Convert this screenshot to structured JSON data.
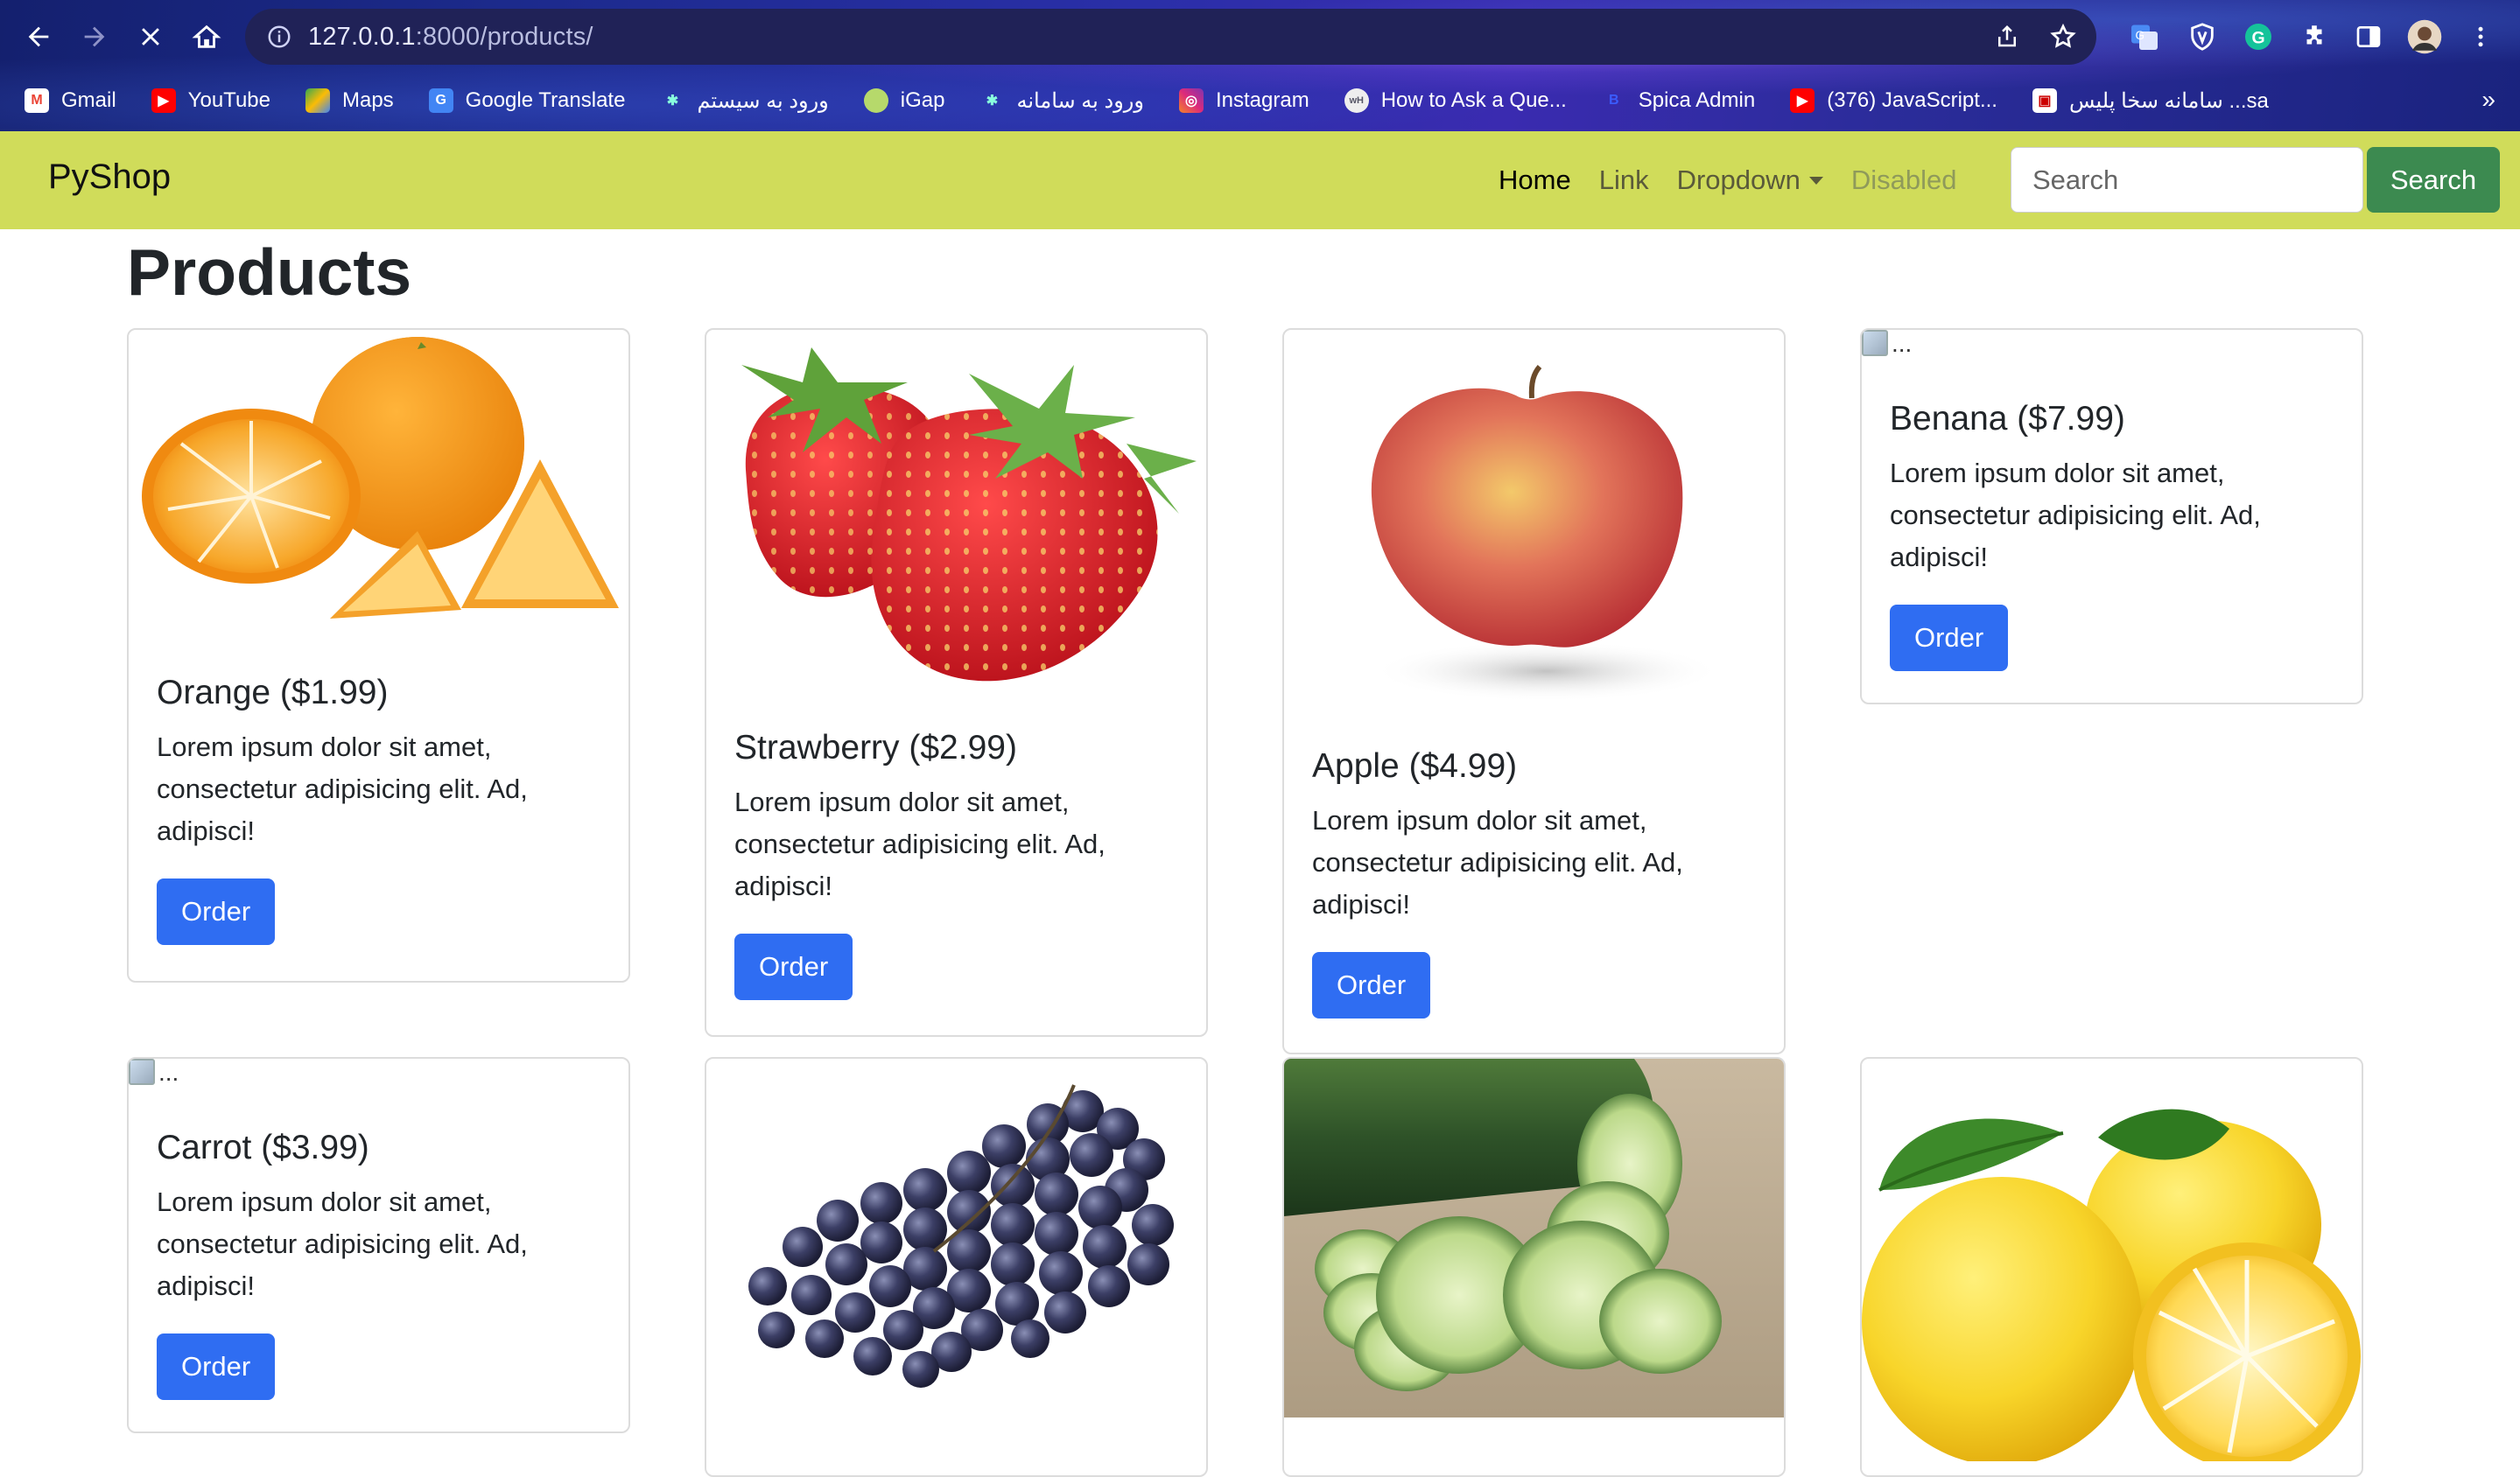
{
  "browser": {
    "url_host": "127.0.0.1",
    "url_path": ":8000/products/",
    "bookmarks": [
      {
        "label": "Gmail",
        "color": "#ea4335",
        "icon": "gmail-icon"
      },
      {
        "label": "YouTube",
        "color": "#ff0000",
        "icon": "youtube-icon"
      },
      {
        "label": "Maps",
        "color": "#34a853",
        "icon": "maps-icon"
      },
      {
        "label": "Google Translate",
        "color": "#4285f4",
        "icon": "translate-icon"
      },
      {
        "label": "ورود به سیستم",
        "color": "#6c8",
        "icon": "site-icon"
      },
      {
        "label": "iGap",
        "color": "#b6d96b",
        "icon": "igap-icon"
      },
      {
        "label": "ورود به سامانه",
        "color": "#6c8",
        "icon": "site-icon"
      },
      {
        "label": "Instagram",
        "color": "#e1306c",
        "icon": "instagram-icon"
      },
      {
        "label": "How to Ask a Que...",
        "color": "#7a8",
        "icon": "wikihow-icon"
      },
      {
        "label": "Spica Admin",
        "color": "#2c4fd0",
        "icon": "spica-icon"
      },
      {
        "label": "(376) JavaScript...",
        "color": "#ff0000",
        "icon": "youtube-icon"
      },
      {
        "label": "سامانه سخا پلیس ...sa",
        "color": "#fff",
        "icon": "police-icon"
      }
    ],
    "more_label": "»"
  },
  "navbar": {
    "brand": "PyShop",
    "links": {
      "home": "Home",
      "link": "Link",
      "dropdown": "Dropdown",
      "disabled": "Disabled"
    },
    "search_placeholder": "Search",
    "search_button": "Search"
  },
  "page": {
    "title": "Products"
  },
  "products": [
    {
      "name": "Orange ($1.99)",
      "text": "Lorem ipsum dolor sit amet, consectetur adipisicing elit. Ad, adipisci!",
      "button": "Order",
      "image": "orange"
    },
    {
      "name": "Strawberry ($2.99)",
      "text": "Lorem ipsum dolor sit amet, consectetur adipisicing elit. Ad, adipisci!",
      "button": "Order",
      "image": "strawberry"
    },
    {
      "name": "Apple ($4.99)",
      "text": "Lorem ipsum dolor sit amet, consectetur adipisicing elit. Ad, adipisci!",
      "button": "Order",
      "image": "apple"
    },
    {
      "name": "Benana ($7.99)",
      "text": "Lorem ipsum dolor sit amet, consectetur adipisicing elit. Ad, adipisci!",
      "button": "Order",
      "image": "broken",
      "alt": "..."
    },
    {
      "name": "Carrot ($3.99)",
      "text": "Lorem ipsum dolor sit amet, consectetur adipisicing elit. Ad, adipisci!",
      "button": "Order",
      "image": "broken",
      "alt": "..."
    },
    {
      "image": "grapes"
    },
    {
      "image": "cucumber"
    },
    {
      "image": "lemon"
    }
  ]
}
